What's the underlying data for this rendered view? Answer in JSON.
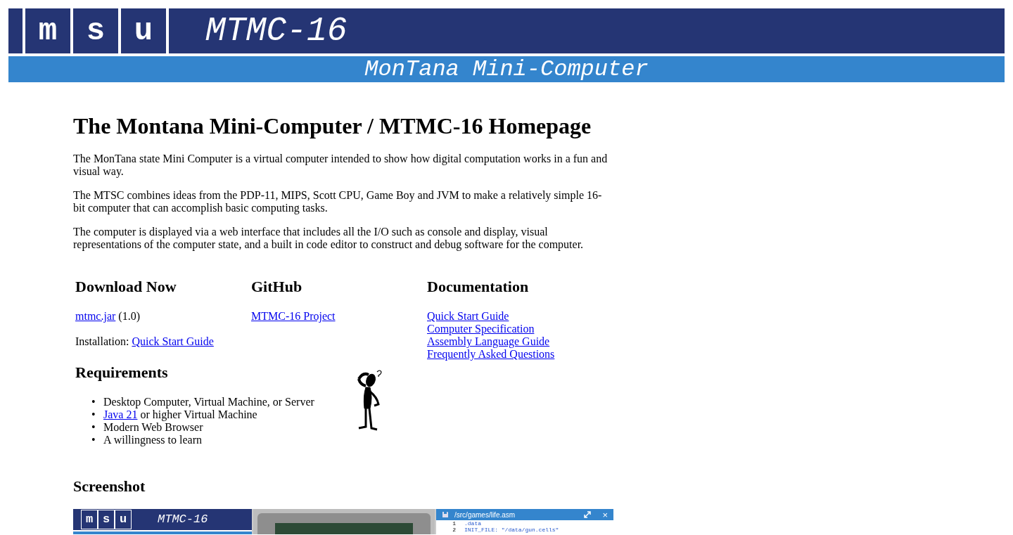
{
  "header": {
    "logo_letters": [
      "m",
      "s",
      "u"
    ],
    "title": "MTMC-16",
    "subtitle": "MonTana Mini-Computer"
  },
  "heading": "The Montana Mini-Computer / MTMC-16 Homepage",
  "paragraphs": [
    "The MonTana state Mini Computer is a virtual computer intended to show how digital computation works in a fun and visual way.",
    "The MTSC combines ideas from the PDP-11, MIPS, Scott CPU, Game Boy and JVM to make a relatively simple 16-bit computer that can accomplish basic computing tasks.",
    "The computer is displayed via a web interface that includes all the I/O such as console and display, visual representations of the computer state, and a built in code editor to construct and debug software for the computer."
  ],
  "columns": [
    {
      "heading": "Download Now",
      "blocks": [
        [
          {
            "kind": "link",
            "text": "mtmc.jar"
          },
          {
            "kind": "text",
            "text": " (1.0)"
          }
        ],
        [
          {
            "kind": "text",
            "text": "Installation: "
          },
          {
            "kind": "link",
            "text": "Quick Start Guide"
          }
        ]
      ]
    },
    {
      "heading": "GitHub",
      "blocks": [
        [
          {
            "kind": "link",
            "text": "MTMC-16 Project"
          }
        ]
      ]
    },
    {
      "heading": "Documentation",
      "links": [
        "Quick Start Guide",
        "Computer Specification",
        "Assembly Language Guide",
        "Frequently Asked Questions"
      ]
    }
  ],
  "requirements": {
    "heading": "Requirements",
    "items": [
      {
        "marker": "•",
        "parts": [
          {
            "kind": "text",
            "text": "Desktop Computer, Virtual Machine, or Server"
          }
        ]
      },
      {
        "marker": "•",
        "parts": [
          {
            "kind": "link",
            "text": "Java 21"
          },
          {
            "kind": "text",
            "text": " or higher Virtual Machine"
          }
        ]
      },
      {
        "marker": "•",
        "parts": [
          {
            "kind": "text",
            "text": "Modern Web Browser"
          }
        ]
      },
      {
        "marker": "•",
        "parts": [
          {
            "kind": "text",
            "text": "A willingness to learn"
          }
        ]
      }
    ]
  },
  "screenshot": {
    "heading": "Screenshot",
    "logo_letters": [
      "m",
      "s",
      "u"
    ],
    "title": "MTMC-16",
    "editor_path": "/src/games/life.asm",
    "close": "×",
    "code_lines": [
      {
        "number": "1",
        "code": ".data"
      },
      {
        "number": "2",
        "code": "INIT_FILE: \"/data/gun.cells\""
      }
    ]
  }
}
